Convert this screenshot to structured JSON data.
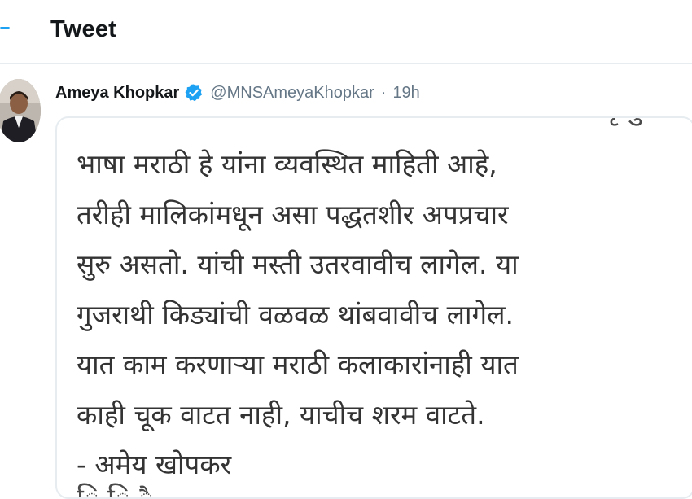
{
  "header": {
    "title": "Tweet",
    "back_icon": "back-arrow-icon",
    "accent": "#1da1f2"
  },
  "tweet": {
    "author_name": "Ameya Khopkar",
    "verified": true,
    "verified_color": "#1da1f2",
    "handle": "@MNSAmeyaKhopkar",
    "separator": "·",
    "time": "19h",
    "image_text": {
      "top_fragment": "ृ        ु",
      "lines": [
        "भाषा मराठी हे यांना व्यवस्थित माहिती आहे,",
        "तरीही मालिकांमधून असा पद्धतशीर अपप्रचार",
        "सुरु असतो. यांची मस्ती उतरवावीच लागेल. या",
        "गुजराथी किड्यांची वळवळ थांबवावीच लागेल.",
        "यात काम करणाऱ्या मराठी कलाकारांनाही यात",
        "काही चूक वाटत नाही, याचीच शरम वाटते.",
        "- अमेय खोपकर"
      ],
      "bottom_fragment": "ि  ि    ै"
    }
  }
}
